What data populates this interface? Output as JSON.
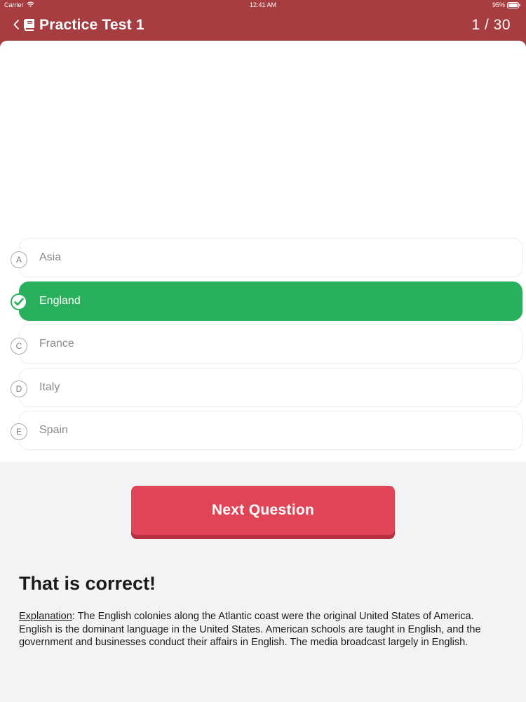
{
  "status_bar": {
    "carrier": "Carrier",
    "time": "12:41 AM",
    "battery": "95%"
  },
  "header": {
    "title": "Practice Test 1",
    "counter": "1 / 30",
    "background_color": "#a63d40"
  },
  "options": [
    {
      "letter": "A",
      "label": "Asia",
      "selected": false
    },
    {
      "letter": "B",
      "label": "England",
      "selected": true
    },
    {
      "letter": "C",
      "label": "France",
      "selected": false
    },
    {
      "letter": "D",
      "label": "Italy",
      "selected": false
    },
    {
      "letter": "E",
      "label": "Spain",
      "selected": false
    }
  ],
  "colors": {
    "correct": "#29b05c",
    "button": "#df4556"
  },
  "next_button": {
    "label": "Next Question"
  },
  "feedback": {
    "title": "That is correct!",
    "explanation_label": "Explanation",
    "explanation_text": ": The English colonies along the Atlantic coast were the original United States of America. English is the dominant language in the United States. American schools are taught in English, and the government and businesses conduct their affairs in English. The media broadcast largely in English."
  }
}
